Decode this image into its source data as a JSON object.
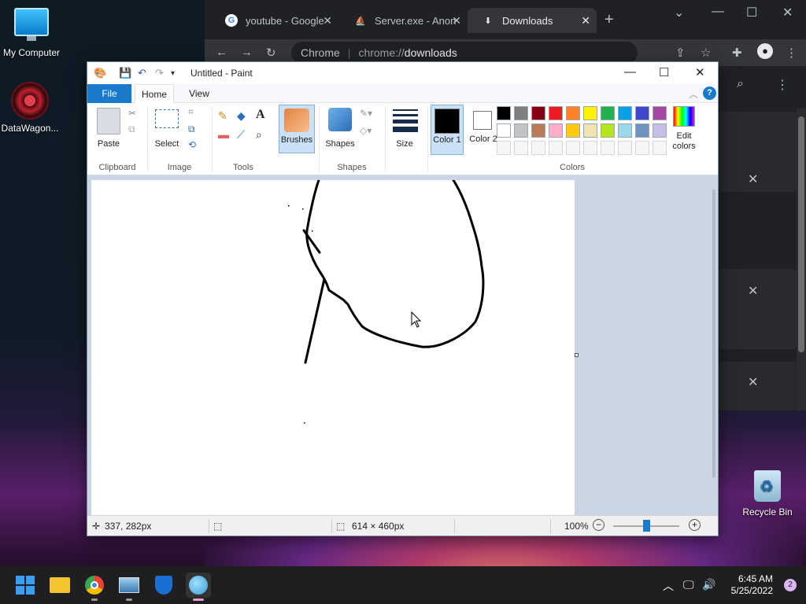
{
  "desktop": {
    "icons": [
      {
        "label": "My Computer"
      },
      {
        "label": "DataWagon..."
      },
      {
        "label": "Recycle Bin"
      }
    ]
  },
  "chrome": {
    "tabs": [
      {
        "label": "youtube - Google"
      },
      {
        "label": "Server.exe - Anon"
      },
      {
        "label": "Downloads"
      }
    ],
    "omnibox": {
      "site": "Chrome",
      "scheme": "chrome://",
      "path": "downloads"
    }
  },
  "paint": {
    "title": "Untitled - Paint",
    "tabs": {
      "file": "File",
      "home": "Home",
      "view": "View"
    },
    "ribbon": {
      "paste": "Paste",
      "select": "Select",
      "brushes": "Brushes",
      "shapes": "Shapes",
      "size": "Size",
      "color1": "Color 1",
      "color2": "Color 2",
      "edit_colors": "Edit colors",
      "groups": {
        "clipboard": "Clipboard",
        "image": "Image",
        "tools": "Tools",
        "shapes": "Shapes",
        "colors": "Colors"
      }
    },
    "palette_row1": [
      "#000000",
      "#7f7f7f",
      "#880015",
      "#ed1c24",
      "#ff7f27",
      "#fff200",
      "#22b14c",
      "#00a2e8",
      "#3f48cc",
      "#a349a4"
    ],
    "palette_row2": [
      "#ffffff",
      "#c3c3c3",
      "#b97a57",
      "#ffaec9",
      "#ffc90e",
      "#efe4b0",
      "#b5e61d",
      "#99d9ea",
      "#7092be",
      "#c8bfe7"
    ],
    "color1": "#000000",
    "color2": "#ffffff",
    "status": {
      "cursor_pos": "337, 282px",
      "canvas_size": "614 × 460px",
      "zoom": "100%",
      "zoom_level": 0.5
    }
  },
  "taskbar": {
    "time": "6:45 AM",
    "date": "5/25/2022",
    "notifications": "2"
  }
}
